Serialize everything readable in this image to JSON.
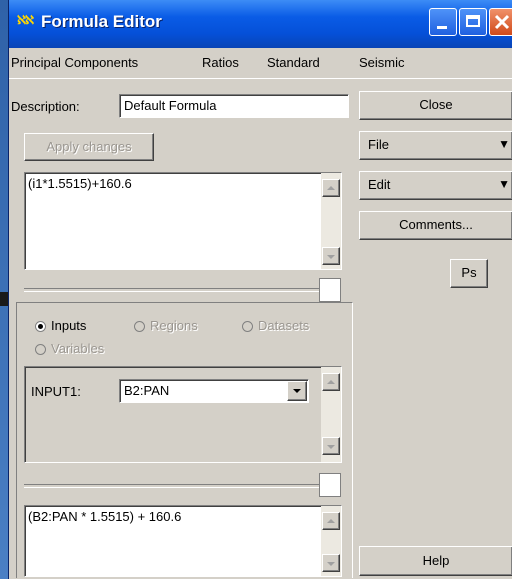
{
  "window": {
    "title": "Formula Editor",
    "icon_text": "ℵℵ"
  },
  "menu": [
    "Principal Components",
    "Ratios",
    "Standard",
    "Seismic"
  ],
  "description": {
    "label": "Description:",
    "value": "Default Formula"
  },
  "apply_label": "Apply changes",
  "formula_text": "(i1*1.5515)+160.6",
  "radios": {
    "inputs": "Inputs",
    "regions": "Regions",
    "datasets": "Datasets",
    "variables": "Variables",
    "selected": "inputs"
  },
  "input_row": {
    "label": "INPUT1:",
    "value": "B2:PAN"
  },
  "expression_text": "(B2:PAN * 1.5515) + 160.6",
  "right": {
    "close": "Close",
    "file": "File",
    "edit": "Edit",
    "comments": "Comments...",
    "ps": "Ps",
    "help": "Help",
    "dropdown_glyph": "▼"
  }
}
